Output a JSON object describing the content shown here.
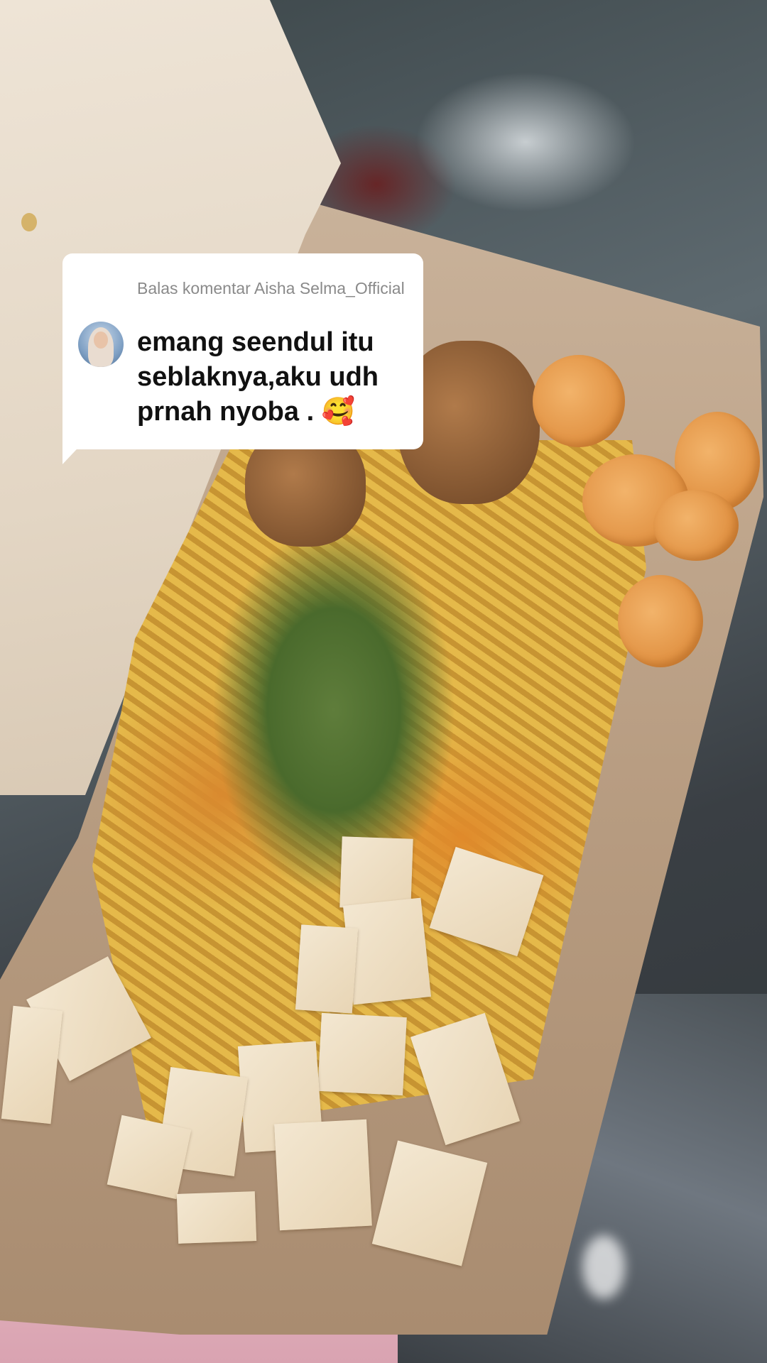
{
  "reply": {
    "header": "Balas komentar Aisha Selma_Official",
    "comment": "emang seendul itu seblaknya,aku udh prnah nyoba . 🥰",
    "avatar_icon": "user-avatar-icon"
  },
  "colors": {
    "card_bg": "#ffffff",
    "header_text": "#8a8a8a",
    "comment_text": "#111111"
  }
}
